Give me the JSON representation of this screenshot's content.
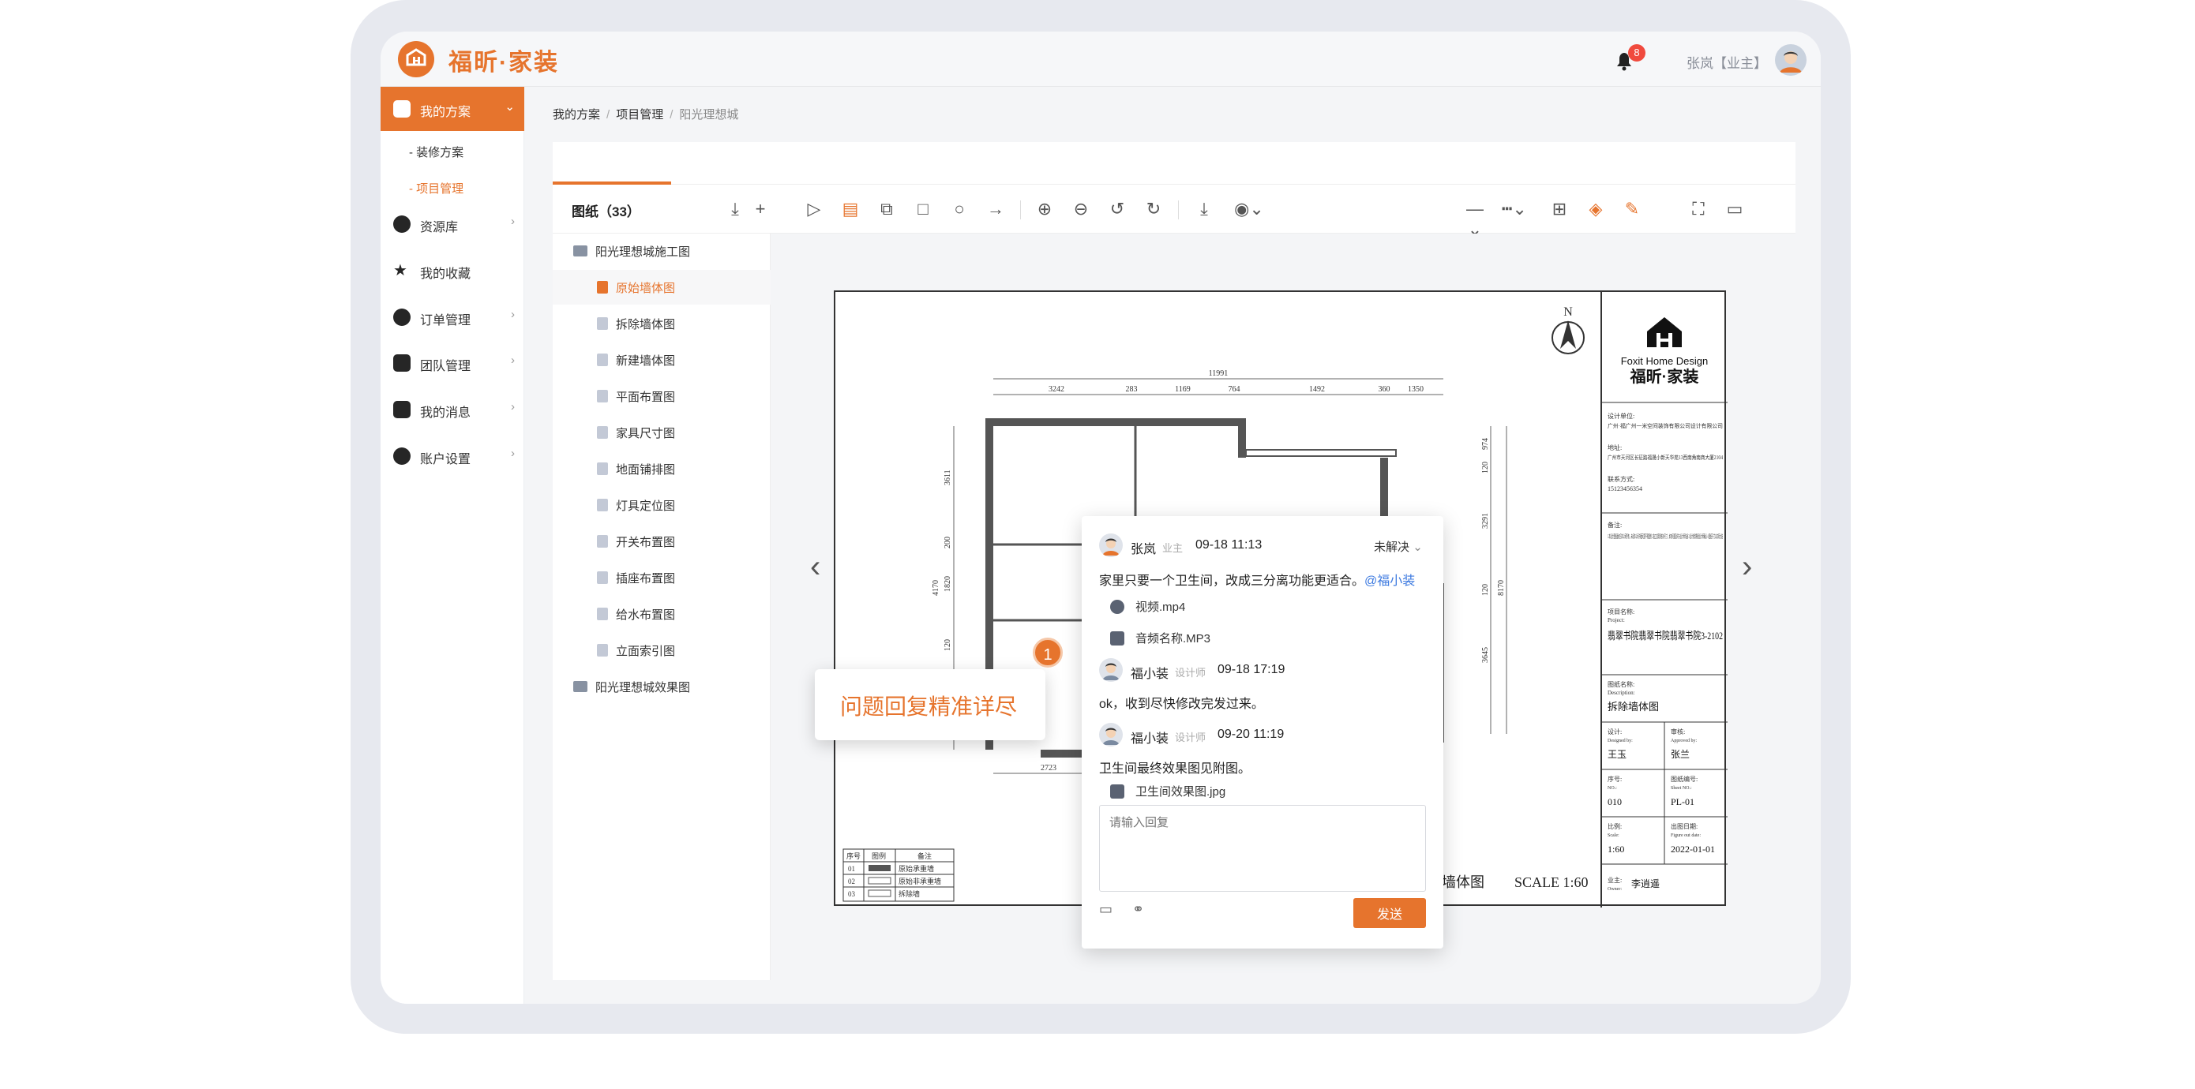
{
  "header": {
    "brand": "福昕·家装",
    "notifications": "8",
    "user": "张岚【业主】"
  },
  "sidebar": {
    "items": [
      {
        "label": "我的方案",
        "icon": "doc-icon"
      },
      {
        "label": "资源库",
        "icon": "palette-icon"
      },
      {
        "label": "我的收藏",
        "icon": "star-icon"
      },
      {
        "label": "订单管理",
        "icon": "coin-icon"
      },
      {
        "label": "团队管理",
        "icon": "team-icon"
      },
      {
        "label": "我的消息",
        "icon": "bell-icon"
      },
      {
        "label": "账户设置",
        "icon": "gear-icon"
      }
    ],
    "sub": [
      "- 装修方案",
      "- 项目管理"
    ]
  },
  "breadcrumb": {
    "items": [
      "我的方案",
      "项目管理",
      "阳光理想城"
    ]
  },
  "toolbar": {
    "title": "图纸（33）"
  },
  "tree": {
    "folder1": "阳光理想城施工图",
    "files": [
      "原始墙体图",
      "拆除墙体图",
      "新建墙体图",
      "平面布置图",
      "家具尺寸图",
      "地面铺排图",
      "灯具定位图",
      "开关布置图",
      "插座布置图",
      "给水布置图",
      "立面索引图"
    ],
    "folder2": "阳光理想城效果图"
  },
  "drawing": {
    "north": "N",
    "dims_top": [
      "11991",
      "3242",
      "283",
      "1169",
      "764",
      "1492",
      "360",
      "1350"
    ],
    "dim_bottom": "2723",
    "dims_left": [
      "3611",
      "200",
      "1820",
      "120",
      "4170"
    ],
    "dims_right": [
      "974",
      "120",
      "3291",
      "120",
      "3645",
      "8170"
    ],
    "title_partial": "除墙体图",
    "scale": "SCALE 1:60",
    "legend_headers": [
      "序号",
      "图例",
      "备注"
    ],
    "legend_rows": [
      [
        "01",
        "原始承重墙"
      ],
      [
        "02",
        "原始非承重墙"
      ],
      [
        "03",
        "拆除墙"
      ]
    ],
    "titleblock": {
      "brand_en": "Foxit Home Design",
      "brand_cn": "福昕·家装",
      "design_unit_label": "设计单位:",
      "design_unit": "广州·福广州一米空间装饰有限公司设计有限公司",
      "address_label": "地址:",
      "address": "广州市天河区长征路福晟小新天华苑13西南角南商大厦2104",
      "contact_label": "联系方式:",
      "contact": "15123456354",
      "notes_label": "备注:",
      "notes": "1.本设计图纸版权归本公司所有，未经本公司书面同意不得复制 2.施工前现场核对尺寸，如有问题及时与设计师沟通 3.设计修改需经设计师确认 4.图纸尺寸以实际为准",
      "project_label": "项目名称:",
      "project_label_en": "Project:",
      "project": "翡翠书院翡翠书院翡翠书院3-2102",
      "drawing_label": "图纸名称:",
      "drawing_label_en": "Description:",
      "drawing_name": "拆除墙体图",
      "designer_label": "设计:",
      "designer_label_en": "Designed by:",
      "designer": "王玉",
      "approver_label": "审核:",
      "approver_label_en": "Approved by:",
      "approver": "张兰",
      "no_label": "序号:",
      "no_label_en": "NO.:",
      "no": "010",
      "sheet_label": "图纸编号:",
      "sheet_label_en": "Sheet NO.:",
      "sheet": "PL-01",
      "scale_label": "比例:",
      "scale_label_en": "Scale:",
      "scale": "1:60",
      "date_label": "出图日期:",
      "date_label_en": "Figure out date:",
      "date": "2022-01-01",
      "owner_label": "业主:",
      "owner_label_en": "Owner:",
      "owner": "李逍遥"
    }
  },
  "callout": {
    "text": "问题回复精准详尽",
    "pin": "1"
  },
  "comment": {
    "status": "未解决",
    "first": {
      "name": "张岚",
      "role": "业主",
      "time": "09-18 11:13",
      "msg": "家里只要一个卫生间，改成三分离功能更适合。",
      "mention": "@福小装"
    },
    "attachments": [
      "视频.mp4",
      "音频名称.MP3"
    ],
    "second": {
      "name": "福小装",
      "role": "设计师",
      "time": "09-18 17:19",
      "msg": "ok，收到尽快修改完发过来。"
    },
    "third": {
      "name": "福小装",
      "role": "设计师",
      "time": "09-20 11:19",
      "msg": "卫生间最终效果图见附图。"
    },
    "image": "卫生间效果图.jpg",
    "placeholder": "请输入回复",
    "send": "发送"
  }
}
